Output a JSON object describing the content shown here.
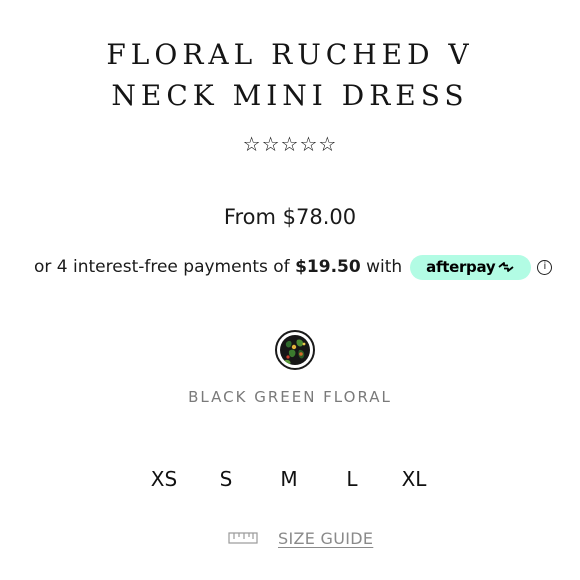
{
  "product": {
    "title_line1": "FLORAL RUCHED V",
    "title_line2": "NECK MINI DRESS",
    "rating_stars": "☆☆☆☆☆",
    "rating_value": 0,
    "rating_max": 5,
    "price": "From $78.00"
  },
  "installments": {
    "prefix": "or 4 interest-free payments of",
    "amount": "$19.50",
    "suffix": "with",
    "provider": "afterpay",
    "provider_color": "#b2fce4",
    "info_icon": "info-icon",
    "info_glyph": "i"
  },
  "color": {
    "selected_name": "BLACK GREEN FLORAL",
    "swatch_icon": "floral-swatch"
  },
  "sizes": [
    "XS",
    "S",
    "M",
    "L",
    "XL"
  ],
  "size_guide": {
    "label": "SIZE GUIDE",
    "icon": "ruler-icon"
  }
}
